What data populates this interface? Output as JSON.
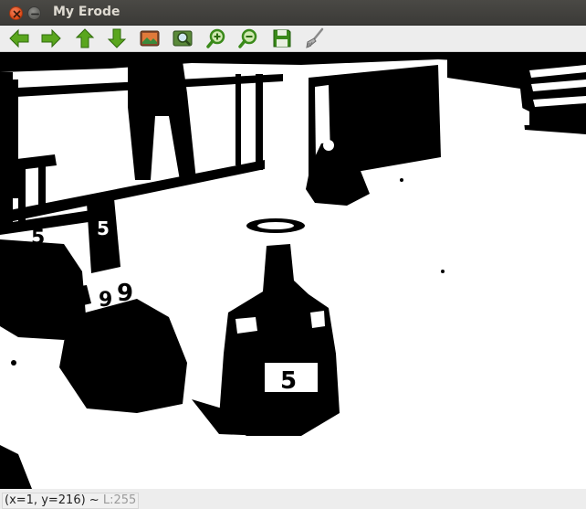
{
  "window": {
    "title": "My Erode",
    "close_icon": "close-icon",
    "minimize_icon": "minimize-icon"
  },
  "toolbar": {
    "buttons": [
      {
        "icon": "arrow-left-icon",
        "color": "#4a9a1c"
      },
      {
        "icon": "arrow-right-icon",
        "color": "#4a9a1c"
      },
      {
        "icon": "arrow-up-icon",
        "color": "#4a9a1c"
      },
      {
        "icon": "arrow-down-icon",
        "color": "#4a9a1c"
      },
      {
        "icon": "save-image-icon",
        "color": "#c85a2a"
      },
      {
        "icon": "zoom-fit-icon",
        "color": "#3a8a3a"
      },
      {
        "icon": "zoom-in-icon",
        "color": "#3a8a1a"
      },
      {
        "icon": "zoom-out-icon",
        "color": "#3a8a1a"
      },
      {
        "icon": "floppy-save-icon",
        "color": "#3a8a1a"
      },
      {
        "icon": "properties-brush-icon",
        "color": "#9a9a9a"
      }
    ]
  },
  "status": {
    "coords": "(x=1, y=216) ~ ",
    "luminance": "L:255"
  }
}
